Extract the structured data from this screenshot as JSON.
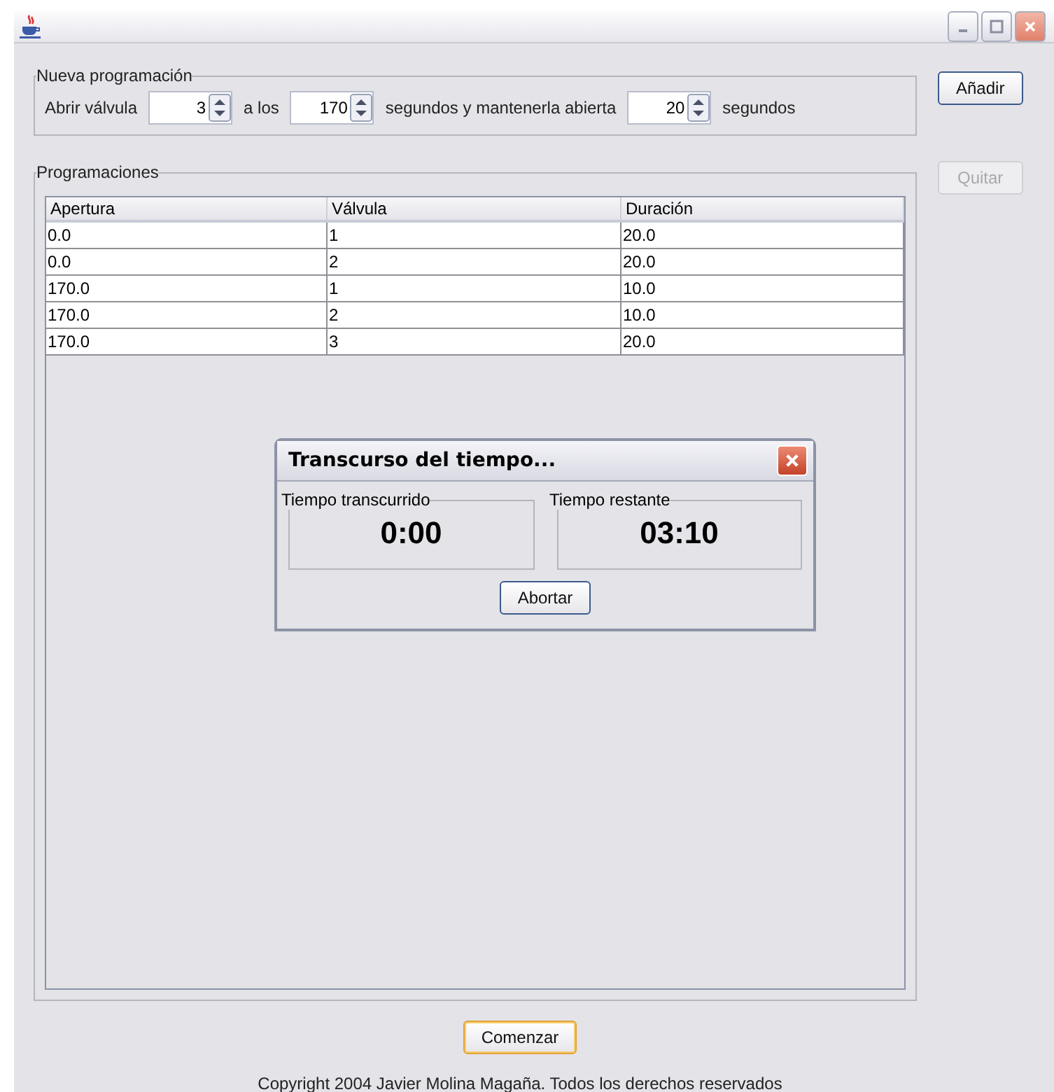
{
  "new_schedule": {
    "legend": "Nueva programación",
    "parts": [
      {
        "kind": "label",
        "text": "Abrir válvula"
      },
      {
        "kind": "spinner",
        "value": "3"
      },
      {
        "kind": "label",
        "text": "a los"
      },
      {
        "kind": "spinner",
        "value": "170"
      },
      {
        "kind": "label",
        "text": "segundos y mantenerla abierta"
      },
      {
        "kind": "spinner",
        "value": "20"
      },
      {
        "kind": "label",
        "text": "segundos"
      }
    ]
  },
  "side_buttons": [
    {
      "label": "Añadir",
      "disabled": false
    },
    {
      "label": "Quitar",
      "disabled": true
    }
  ],
  "schedules": {
    "legend": "Programaciones",
    "columns": [
      "Apertura",
      "Válvula",
      "Duración"
    ],
    "rows": [
      [
        "0.0",
        "1",
        "20.0"
      ],
      [
        "0.0",
        "2",
        "20.0"
      ],
      [
        "170.0",
        "1",
        "10.0"
      ],
      [
        "170.0",
        "2",
        "10.0"
      ],
      [
        "170.0",
        "3",
        "20.0"
      ]
    ]
  },
  "dialog": {
    "title": "Transcurso del tiempo...",
    "panels": [
      {
        "legend": "Tiempo transcurrido",
        "value": "0:00"
      },
      {
        "legend": "Tiempo restante",
        "value": "03:10"
      }
    ],
    "button": "Abortar"
  },
  "start_button": {
    "label": "Comenzar",
    "default": true
  },
  "footer": "Copyright 2004 Javier Molina Magaña. Todos los derechos reservados"
}
